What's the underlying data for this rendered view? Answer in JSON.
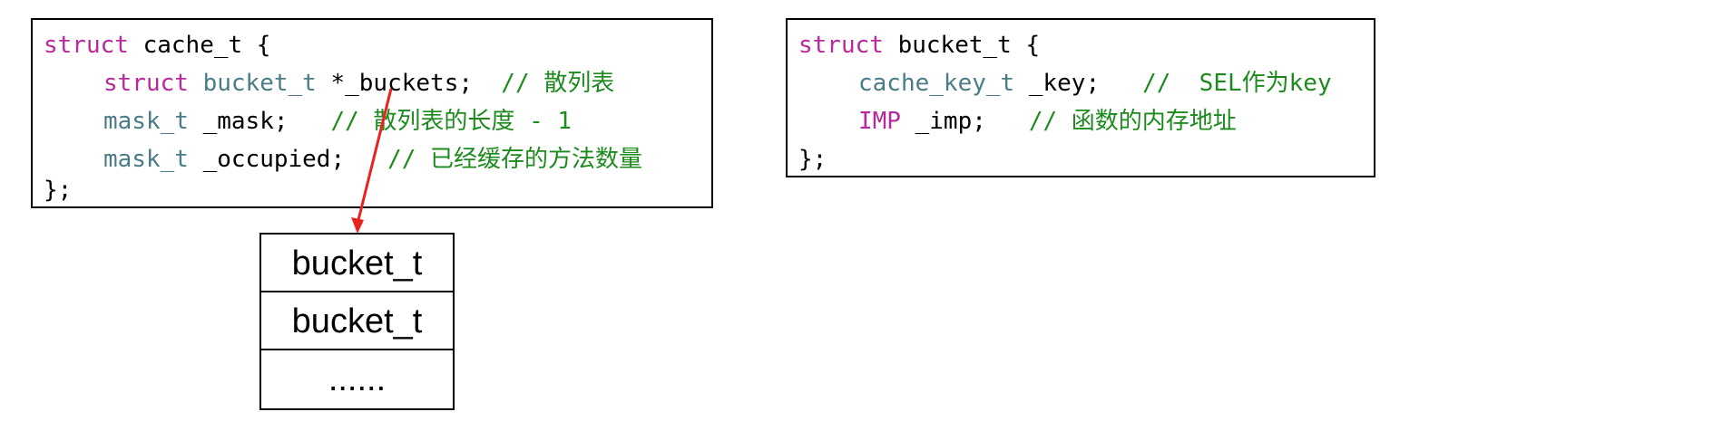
{
  "cache_struct": {
    "line1": {
      "kw": "struct",
      "name": " cache_t {"
    },
    "line2": {
      "kw": "struct",
      "type": " bucket_t",
      "rest": " *_buckets;",
      "comment": "  // 散列表"
    },
    "line3": {
      "type": "mask_t",
      "rest": " _mask;",
      "comment": "   // 散列表的长度 - 1"
    },
    "line4": {
      "type": "mask_t",
      "rest": " _occupied;",
      "comment": "   // 已经缓存的方法数量"
    },
    "line5": "};"
  },
  "bucket_struct": {
    "line1": {
      "kw": "struct",
      "name": " bucket_t {"
    },
    "line2": {
      "type": "cache_key_t",
      "rest": " _key;",
      "comment": "   //  SEL作为key"
    },
    "line3": {
      "kw": "IMP",
      "rest": " _imp;",
      "comment": "   // 函数的内存地址"
    },
    "line4": "};"
  },
  "bucket_array": {
    "cells": [
      "bucket_t",
      "bucket_t",
      "......"
    ]
  },
  "colors": {
    "keyword": "#b8299b",
    "type": "#4a7c87",
    "comment": "#1d8a1d",
    "arrow": "#e8231e"
  }
}
